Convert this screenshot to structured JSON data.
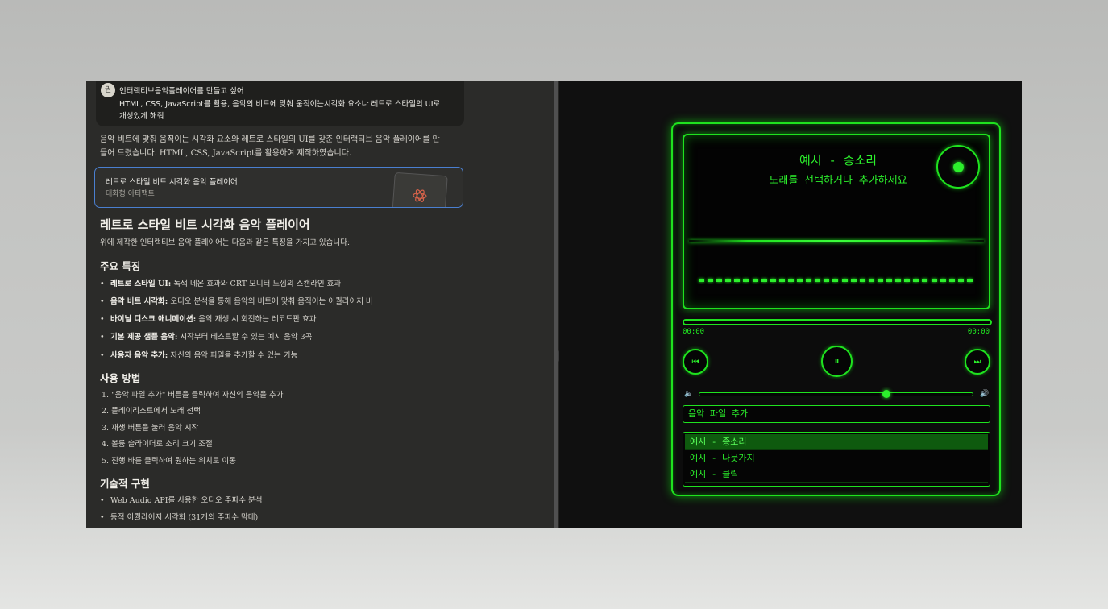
{
  "chat": {
    "avatar_initial": "권",
    "user_message_line1": "인터랙티브음악플레이어를 만들고 싶어",
    "user_message_line2": "HTML, CSS, JavaScript를 활용, 음악의 비트에 맞춰 움직이는시각화 요소나 레트로 스타일의 UI로",
    "user_message_line3": "개성있게 해줘",
    "intro_line1": "음악 비트에 맞춰 움직이는 시각화 요소와 레트로 스타일의 UI를 갖춘 인터랙티브 음악 플레이어를 만",
    "intro_line2": "들어 드렸습니다. HTML, CSS, JavaScript를 활용하여 제작하였습니다.",
    "artifact_title": "레트로 스타일 비트 시각화 음악 플레이어",
    "artifact_subtitle": "대화형 아티팩트",
    "heading": "레트로 스타일 비트 시각화 음악 플레이어",
    "description": "위에 제작한 인터랙티브 음악 플레이어는 다음과 같은 특징을 가지고 있습니다:",
    "features_heading": "주요 특징",
    "features": [
      {
        "bold": "레트로 스타일 UI:",
        "text": " 녹색 네온 효과와 CRT 모니터 느낌의 스캔라인 효과"
      },
      {
        "bold": "음악 비트 시각화:",
        "text": " 오디오 분석을 통해 음악의 비트에 맞춰 움직이는 이퀄라이저 바"
      },
      {
        "bold": "바이닐 디스크 애니메이션:",
        "text": " 음악 재생 시 회전하는 레코드판 효과"
      },
      {
        "bold": "기본 제공 샘플 음악:",
        "text": " 시작부터 테스트할 수 있는 예시 음악 3곡"
      },
      {
        "bold": "사용자 음악 추가:",
        "text": " 자신의 음악 파일을 추가할 수 있는 기능"
      }
    ],
    "usage_heading": "사용 방법",
    "usage": [
      "1. \"음악 파일 추가\" 버튼을 클릭하여 자신의 음악을 추가",
      "2. 플레이리스트에서 노래 선택",
      "3. 재생 버튼을 눌러 음악 시작",
      "4. 볼륨 슬라이더로 소리 크기 조절",
      "5. 진행 바를 클릭하여 원하는 위치로 이동"
    ],
    "tech_heading": "기술적 구현",
    "tech": [
      "Web Audio API를 사용한 오디오 주파수 분석",
      "동적 이퀄라이저 시각화 (31개의 주파수 막대)"
    ]
  },
  "player": {
    "song_title": "예시 - 종소리",
    "song_subtitle": "노래를 선택하거나 추가하세요",
    "current_time": "00:00",
    "duration": "00:00",
    "prev_icon": "⏮",
    "play_icon": "⏸",
    "next_icon": "⏭",
    "volume_low_icon": "🔈",
    "volume_high_icon": "🔊",
    "volume_level": 0.69,
    "add_file_label": "음악 파일 추가",
    "playlist": [
      "예시 - 종소리",
      "예시 - 나뭇가지",
      "예시 - 클릭"
    ],
    "active_index": 0,
    "equalizer_bar_count": 31,
    "accent_color": "#1fe21f"
  }
}
